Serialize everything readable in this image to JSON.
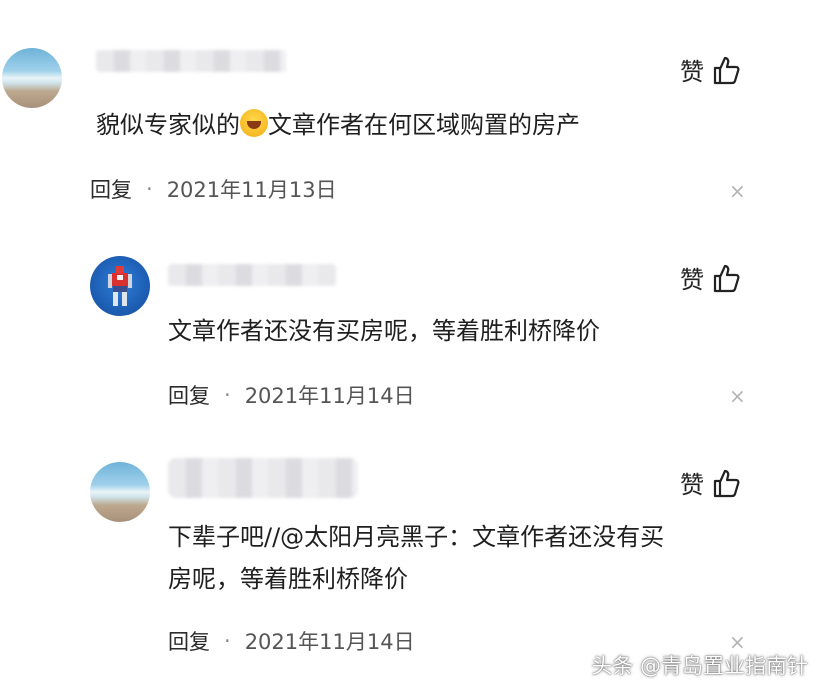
{
  "comments": [
    {
      "text": "貌似专家似的",
      "text_after_emoji": "文章作者在何区域购置的房产",
      "like_label": "赞",
      "reply_label": "回复",
      "separator": "·",
      "date": "2021年11月13日",
      "close_glyph": "×"
    },
    {
      "text": "文章作者还没有买房呢，等着胜利桥降价",
      "like_label": "赞",
      "reply_label": "回复",
      "separator": "·",
      "date": "2021年11月14日",
      "close_glyph": "×"
    },
    {
      "text_line1": "下辈子吧//@太阳月亮黑子：文章作者还没有买",
      "text_line2": "房呢，等着胜利桥降价",
      "like_label": "赞",
      "reply_label": "回复",
      "separator": "·",
      "date": "2021年11月14日",
      "close_glyph": "×"
    }
  ],
  "watermark": "头条 @青岛置业指南针",
  "icons": {
    "like": "thumbs-up-icon",
    "close": "close-icon",
    "emoji": "laughing-crying-emoji"
  }
}
